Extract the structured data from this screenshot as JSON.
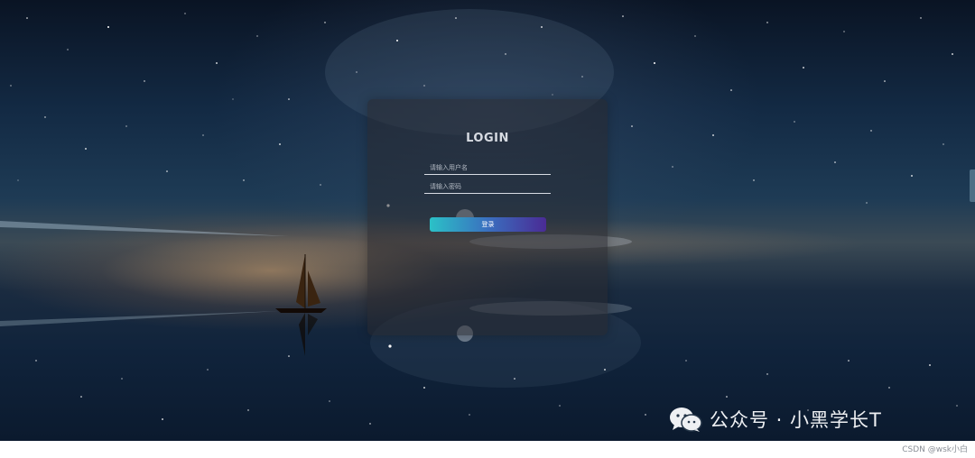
{
  "login": {
    "title": "LOGIN",
    "username_placeholder": "请输入用户名",
    "password_placeholder": "请输入密码",
    "submit_label": "登录"
  },
  "watermark": {
    "icon": "wechat-icon",
    "text": "公众号 · 小黑学长T"
  },
  "footer": {
    "credit": "CSDN @wsk小白"
  },
  "colors": {
    "button_gradient_start": "#2bc1c7",
    "button_gradient_end": "#4a2b95",
    "card_background": "rgba(40,40,46,0.52)"
  }
}
